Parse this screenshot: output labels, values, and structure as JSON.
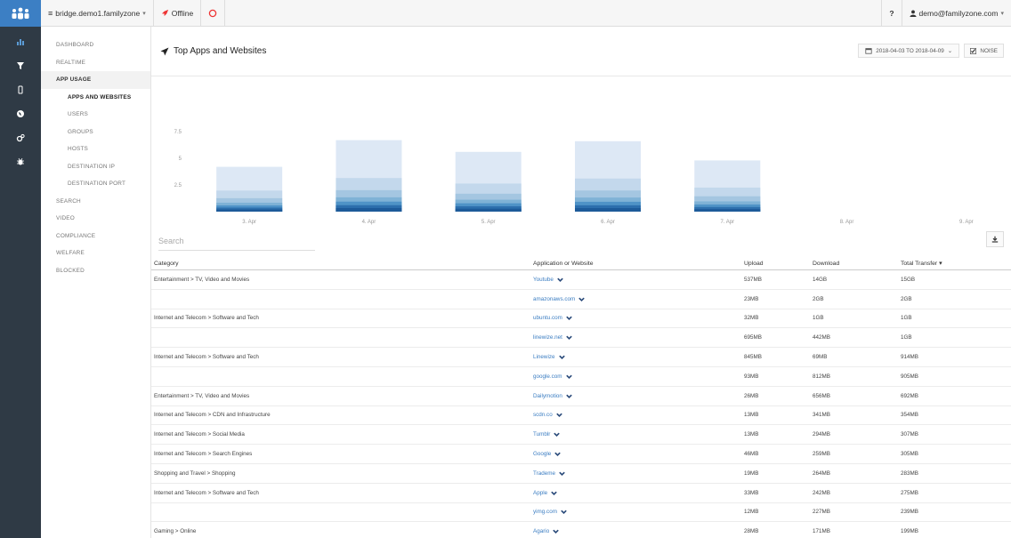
{
  "topbar": {
    "site": "bridge.demo1.familyzone",
    "status": "Offline",
    "help": "?",
    "user": "demo@familyzone.com"
  },
  "nav": {
    "items": [
      {
        "label": "DASHBOARD",
        "kind": "top"
      },
      {
        "label": "REALTIME",
        "kind": "top"
      },
      {
        "label": "APP USAGE",
        "kind": "group"
      },
      {
        "label": "APPS AND WEBSITES",
        "kind": "current"
      },
      {
        "label": "USERS",
        "kind": "sub"
      },
      {
        "label": "GROUPS",
        "kind": "sub"
      },
      {
        "label": "HOSTS",
        "kind": "sub"
      },
      {
        "label": "DESTINATION IP",
        "kind": "sub"
      },
      {
        "label": "DESTINATION PORT",
        "kind": "sub"
      },
      {
        "label": "SEARCH",
        "kind": "top"
      },
      {
        "label": "VIDEO",
        "kind": "top"
      },
      {
        "label": "COMPLIANCE",
        "kind": "top"
      },
      {
        "label": "WELFARE",
        "kind": "top"
      },
      {
        "label": "BLOCKED",
        "kind": "top"
      }
    ]
  },
  "header": {
    "title": "Top Apps and Websites",
    "date_range": "2018-04-03 TO 2018-04-09",
    "noise_label": "NOISE"
  },
  "search": {
    "placeholder": "Search"
  },
  "chart_data": {
    "type": "bar",
    "categories": [
      "3. Apr",
      "4. Apr",
      "5. Apr",
      "6. Apr",
      "7. Apr",
      "8. Apr",
      "9. Apr"
    ],
    "yticks": [
      "2.5",
      "5",
      "7.5"
    ],
    "ylim": [
      0,
      10
    ],
    "values": [
      4.2,
      6.7,
      5.6,
      6.6,
      4.8,
      0,
      0
    ],
    "colors": [
      "#dde8f5",
      "#c3d8ec",
      "#a4c6e1",
      "#7fb2d6",
      "#4f93c7",
      "#2d6fad",
      "#1d5a99"
    ]
  },
  "table": {
    "headers": [
      "Category",
      "Application or Website",
      "Upload",
      "Download",
      "Total Transfer"
    ],
    "rows": [
      {
        "category": "Entertainment > TV, Video and Movies",
        "app": "Youtube",
        "upload": "537MB",
        "download": "14GB",
        "total": "15GB"
      },
      {
        "category": "",
        "app": "amazonaws.com",
        "upload": "23MB",
        "download": "2GB",
        "total": "2GB"
      },
      {
        "category": "Internet and Telecom > Software and Tech",
        "app": "ubuntu.com",
        "upload": "32MB",
        "download": "1GB",
        "total": "1GB"
      },
      {
        "category": "",
        "app": "linewize.net",
        "upload": "695MB",
        "download": "442MB",
        "total": "1GB"
      },
      {
        "category": "Internet and Telecom > Software and Tech",
        "app": "Linewize",
        "upload": "845MB",
        "download": "69MB",
        "total": "914MB"
      },
      {
        "category": "",
        "app": "google.com",
        "upload": "93MB",
        "download": "812MB",
        "total": "905MB"
      },
      {
        "category": "Entertainment > TV, Video and Movies",
        "app": "Dailymotion",
        "upload": "26MB",
        "download": "656MB",
        "total": "692MB"
      },
      {
        "category": "Internet and Telecom > CDN and Infrastructure",
        "app": "scdn.co",
        "upload": "13MB",
        "download": "341MB",
        "total": "354MB"
      },
      {
        "category": "Internet and Telecom > Social Media",
        "app": "Tumblr",
        "upload": "13MB",
        "download": "294MB",
        "total": "307MB"
      },
      {
        "category": "Internet and Telecom > Search Engines",
        "app": "Google",
        "upload": "46MB",
        "download": "259MB",
        "total": "305MB"
      },
      {
        "category": "Shopping and Travel > Shopping",
        "app": "Trademe",
        "upload": "19MB",
        "download": "264MB",
        "total": "283MB"
      },
      {
        "category": "Internet and Telecom > Software and Tech",
        "app": "Apple",
        "upload": "33MB",
        "download": "242MB",
        "total": "275MB"
      },
      {
        "category": "",
        "app": "yimg.com",
        "upload": "12MB",
        "download": "227MB",
        "total": "239MB"
      },
      {
        "category": "Gaming > Online",
        "app": "Agario",
        "upload": "28MB",
        "download": "171MB",
        "total": "199MB"
      }
    ]
  }
}
